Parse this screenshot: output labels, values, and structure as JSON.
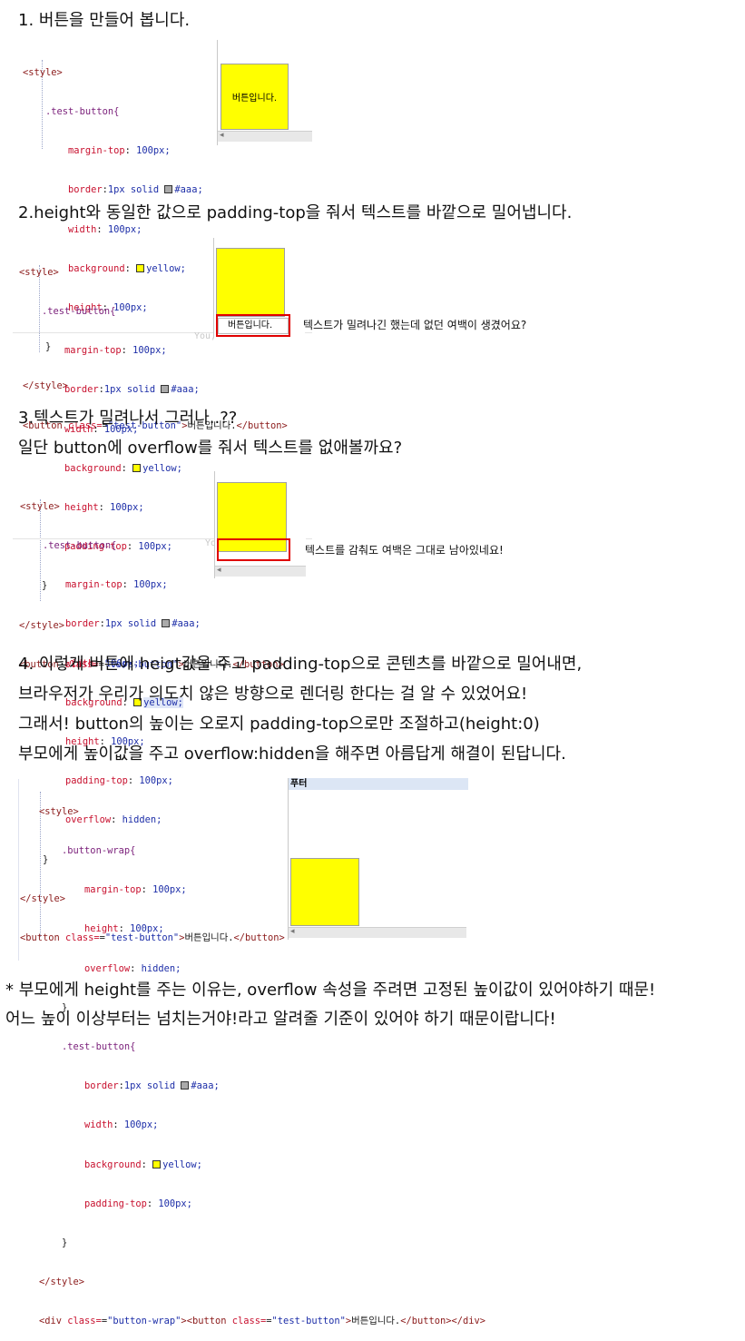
{
  "sections": [
    {
      "heading": "1. 버튼을 만들어 봅니다."
    },
    {
      "heading": "2.height와 동일한 값으로 padding-top을 줘서 텍스트를 바깥으로 밀어냅니다.",
      "note": "텍스트가 밀려나긴 했는데 없던 여백이 생겼어요?"
    },
    {
      "heading_line1": "3.텍스트가 밀려나서 그러나..??",
      "heading_line2": "일단 button에 overflow를 줘서 텍스트를 없애볼까요?",
      "note": "텍스트를 감춰도 여백은 그대로 남아있네요!"
    },
    {
      "lines": [
        "4. 이렇게 버튼에 heigt값을 주고 padding-top으로 콘텐츠를 바깥으로 밀어내면,",
        "브라우저가 우리가 의도치 않은 방향으로 렌더링 한다는 걸 알 수 있었어요!",
        "그래서! button의 높이는 오로지 padding-top으로만 조절하고(height:0)",
        "부모에게 높이값을 주고 overflow:hidden을 해주면 아름답게 해결이 된답니다."
      ],
      "preview_header": "푸터"
    }
  ],
  "code": {
    "style_open": "<style>",
    "style_close": "</style>",
    "test_selector": ".test-button{",
    "wrap_selector": ".button-wrap{",
    "close_brace": "}",
    "props": {
      "margin_top": "margin-top",
      "border": "border",
      "width": "width",
      "background": "background",
      "height": "height",
      "padding_top": "padding-top",
      "overflow": "overflow"
    },
    "values": {
      "px100": "100px;",
      "border_solid": "1px solid ",
      "aaa": "#aaa;",
      "yellow": "yellow;",
      "hidden": "hidden;"
    },
    "button_open": "<button",
    "class_attr": " class=",
    "button_class": "\"test-button\"",
    "button_text": "버튼입니다.",
    "button_close": "</button>",
    "div_open": "<div",
    "wrap_class": "\"button-wrap\"",
    "div_close": "</div>",
    "gt": ">"
  },
  "preview": {
    "button_text": "버튼입니다.",
    "ghost_text": "You,"
  },
  "colors": {
    "swatch_aaa": "#aaaaaa",
    "swatch_yellow": "#ffff00",
    "highlight_red": "#e00000"
  },
  "footer": {
    "line1": "* 부모에게 height를 주는 이유는, overflow 속성을 주려면 고정된 높이값이 있어야하기 때문!",
    "line2": "어느 높이 이상부터는 넘치는거야!라고 알려줄 기준이 있어야 하기 때문이랍니다!"
  }
}
